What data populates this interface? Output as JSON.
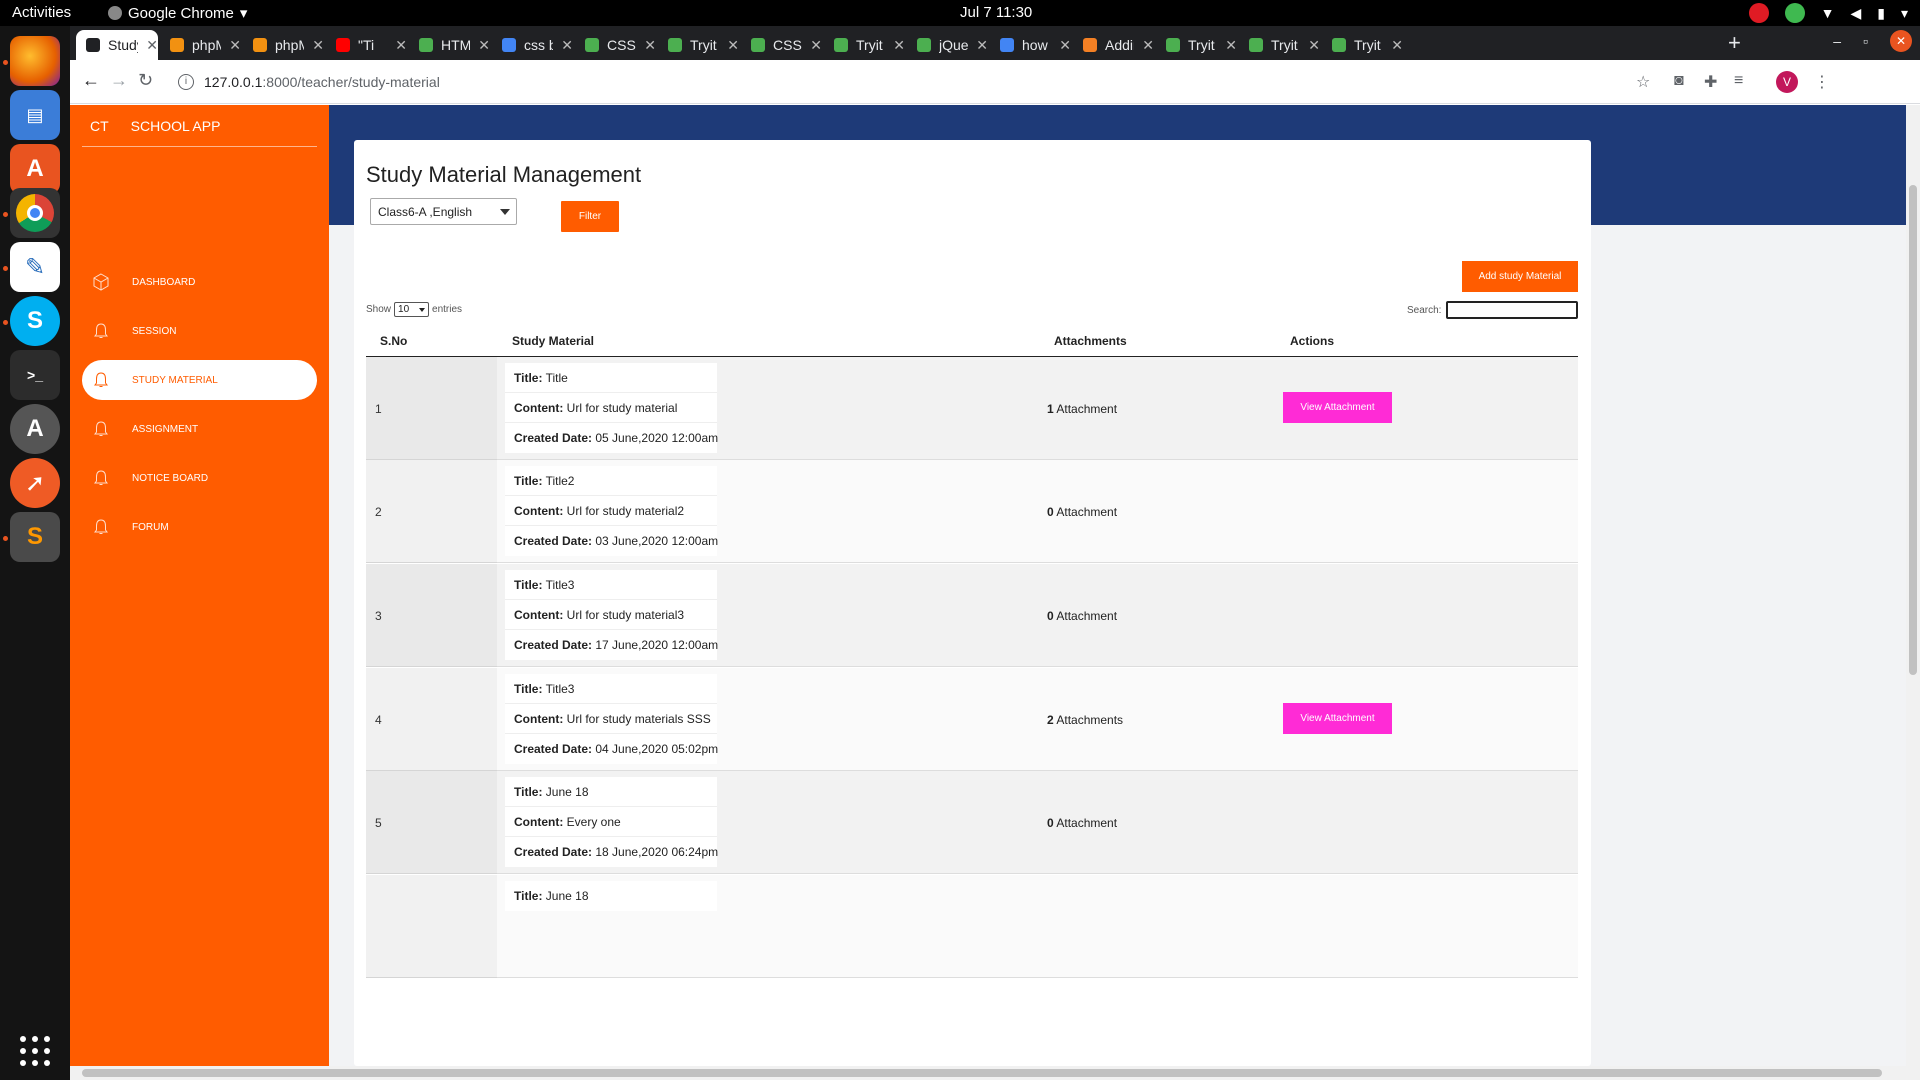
{
  "system": {
    "activities": "Activities",
    "app_name": "Google Chrome",
    "clock": "Jul 7  11:30"
  },
  "browser": {
    "tabs": [
      {
        "label": "Study",
        "active": true,
        "favicon_color": "#202124"
      },
      {
        "label": "phpM",
        "favicon_color": "#f29111"
      },
      {
        "label": "phpM",
        "favicon_color": "#f29111"
      },
      {
        "label": "\"Ti",
        "favicon_color": "#ff0000"
      },
      {
        "label": "HTML",
        "favicon_color": "#4caf50"
      },
      {
        "label": "css bo",
        "favicon_color": "#4285f4"
      },
      {
        "label": "CSS R",
        "favicon_color": "#4caf50"
      },
      {
        "label": "Tryit",
        "favicon_color": "#4caf50"
      },
      {
        "label": "CSS C",
        "favicon_color": "#4caf50"
      },
      {
        "label": "Tryit",
        "favicon_color": "#4caf50"
      },
      {
        "label": "jQuer",
        "favicon_color": "#4caf50"
      },
      {
        "label": "how t",
        "favicon_color": "#4285f4"
      },
      {
        "label": "Addir",
        "favicon_color": "#f48024"
      },
      {
        "label": "Tryit",
        "favicon_color": "#4caf50"
      },
      {
        "label": "Tryit",
        "favicon_color": "#4caf50"
      },
      {
        "label": "Tryit",
        "favicon_color": "#4caf50"
      }
    ],
    "url_host": "127.0.0.1",
    "url_path": ":8000/teacher/study-material",
    "profile_initial": "V"
  },
  "sidebar": {
    "brand_short": "CT",
    "brand_name": "SCHOOL APP",
    "items": [
      {
        "label": "DASHBOARD",
        "icon": "cube-icon"
      },
      {
        "label": "SESSION",
        "icon": "bell-icon"
      },
      {
        "label": "STUDY MATERIAL",
        "icon": "bell-icon",
        "active": true
      },
      {
        "label": "ASSIGNMENT",
        "icon": "bell-icon"
      },
      {
        "label": "NOTICE BOARD",
        "icon": "bell-icon"
      },
      {
        "label": "FORUM",
        "icon": "bell-icon"
      }
    ]
  },
  "main": {
    "title": "Study Material Management",
    "class_select_value": "Class6-A ,English",
    "filter_label": "Filter",
    "add_label": "Add study Material",
    "show_label": "Show",
    "entries_value": "10",
    "entries_label": "entries",
    "search_label": "Search:",
    "columns": [
      "S.No",
      "Study Material",
      "Attachments",
      "Actions"
    ],
    "field_labels": {
      "title": "Title:",
      "content": "Content:",
      "created": "Created Date:"
    },
    "view_label": "View Attachment",
    "rows": [
      {
        "sno": "1",
        "title": "Title",
        "content": "Url for study material",
        "created": "05 June,2020 12:00am",
        "att_count": "1",
        "att_label": "Attachment",
        "has_view": true
      },
      {
        "sno": "2",
        "title": "Title2",
        "content": "Url for study material2",
        "created": "03 June,2020 12:00am",
        "att_count": "0",
        "att_label": "Attachment",
        "has_view": false
      },
      {
        "sno": "3",
        "title": "Title3",
        "content": "Url for study material3",
        "created": "17 June,2020 12:00am",
        "att_count": "0",
        "att_label": "Attachment",
        "has_view": false
      },
      {
        "sno": "4",
        "title": "Title3",
        "content": "Url for study materials SSS",
        "created": "04 June,2020 05:02pm",
        "att_count": "2",
        "att_label": "Attachments",
        "has_view": true
      },
      {
        "sno": "5",
        "title": "June 18",
        "content": "Every one",
        "created": "18 June,2020 06:24pm",
        "att_count": "0",
        "att_label": "Attachment",
        "has_view": false
      }
    ],
    "partial_row_title": "June 18"
  },
  "colors": {
    "accent": "#ff5c00",
    "header_band": "#1e3a78",
    "view_button": "#ff2bd6"
  }
}
